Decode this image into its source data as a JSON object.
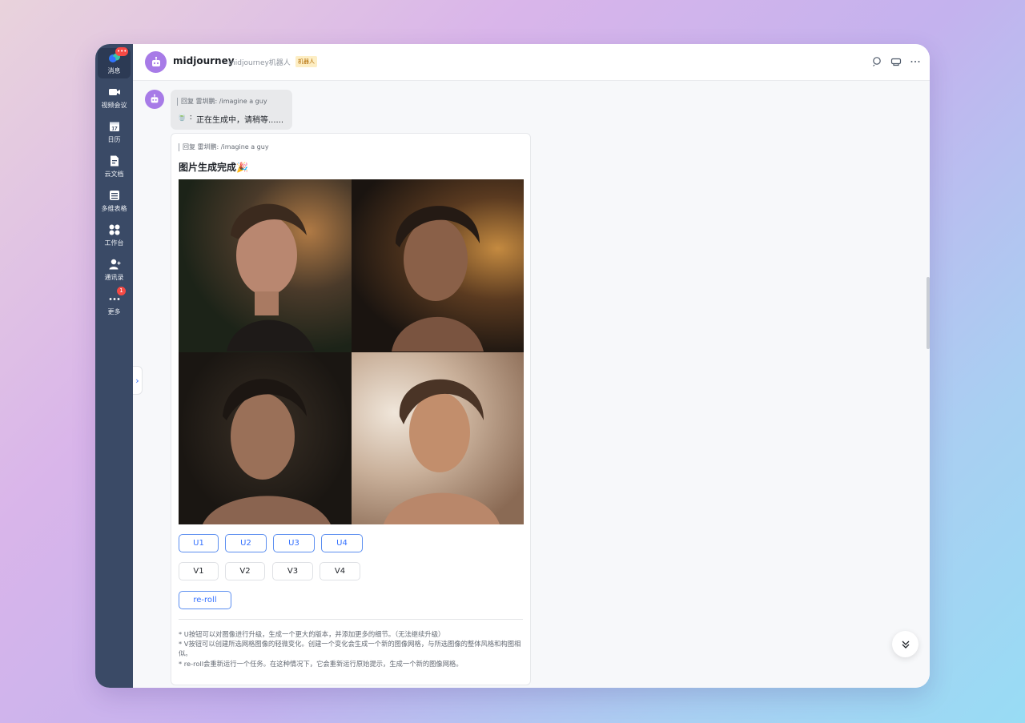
{
  "sidebar": {
    "items": [
      {
        "label": "消息",
        "icon": "chat-bubbles-icon",
        "badge": "•••"
      },
      {
        "label": "视频会议",
        "icon": "video-camera-icon"
      },
      {
        "label": "日历",
        "icon": "calendar-icon",
        "day": "17"
      },
      {
        "label": "云文档",
        "icon": "cloud-doc-icon"
      },
      {
        "label": "多维表格",
        "icon": "table-icon"
      },
      {
        "label": "工作台",
        "icon": "apps-grid-icon"
      },
      {
        "label": "通讯录",
        "icon": "contacts-icon"
      },
      {
        "label": "更多",
        "icon": "more-dots-icon",
        "badge": "1"
      }
    ]
  },
  "header": {
    "title": "midjourney",
    "subtitle": "midjourney机器人",
    "tag": "机器人",
    "icons": [
      "search-icon",
      "chat-mode-icon",
      "more-icon"
    ]
  },
  "messages": {
    "first": {
      "quote": "回复 雷圳鹏: /imagine a guy",
      "status_prefix": "🍵 :",
      "status": "正在生成中，请稍等......"
    },
    "card": {
      "quote": "回复 雷圳鹏: /imagine a guy",
      "title": "图片生成完成🎉",
      "images": [
        "portrait-1",
        "portrait-2",
        "portrait-3",
        "portrait-4"
      ],
      "upscale_buttons": [
        "U1",
        "U2",
        "U3",
        "U4"
      ],
      "variation_buttons": [
        "V1",
        "V2",
        "V3",
        "V4"
      ],
      "reroll_label": "re-roll",
      "notes": [
        "* U按钮可以对图像进行升级，生成一个更大的版本，并添加更多的细节。（无法继续升级）",
        "* V按钮可以创建所选网格图像的轻微变化。创建一个变化会生成一个新的图像网格，与所选图像的整体风格和构图相似。",
        "* re-roll会重新运行一个任务。在这种情况下，它会重新运行原始提示，生成一个新的图像网格。"
      ]
    }
  },
  "colors": {
    "sidebar": "#3a4a66",
    "accent": "#3370ff",
    "bot_avatar": "#a77be7"
  }
}
